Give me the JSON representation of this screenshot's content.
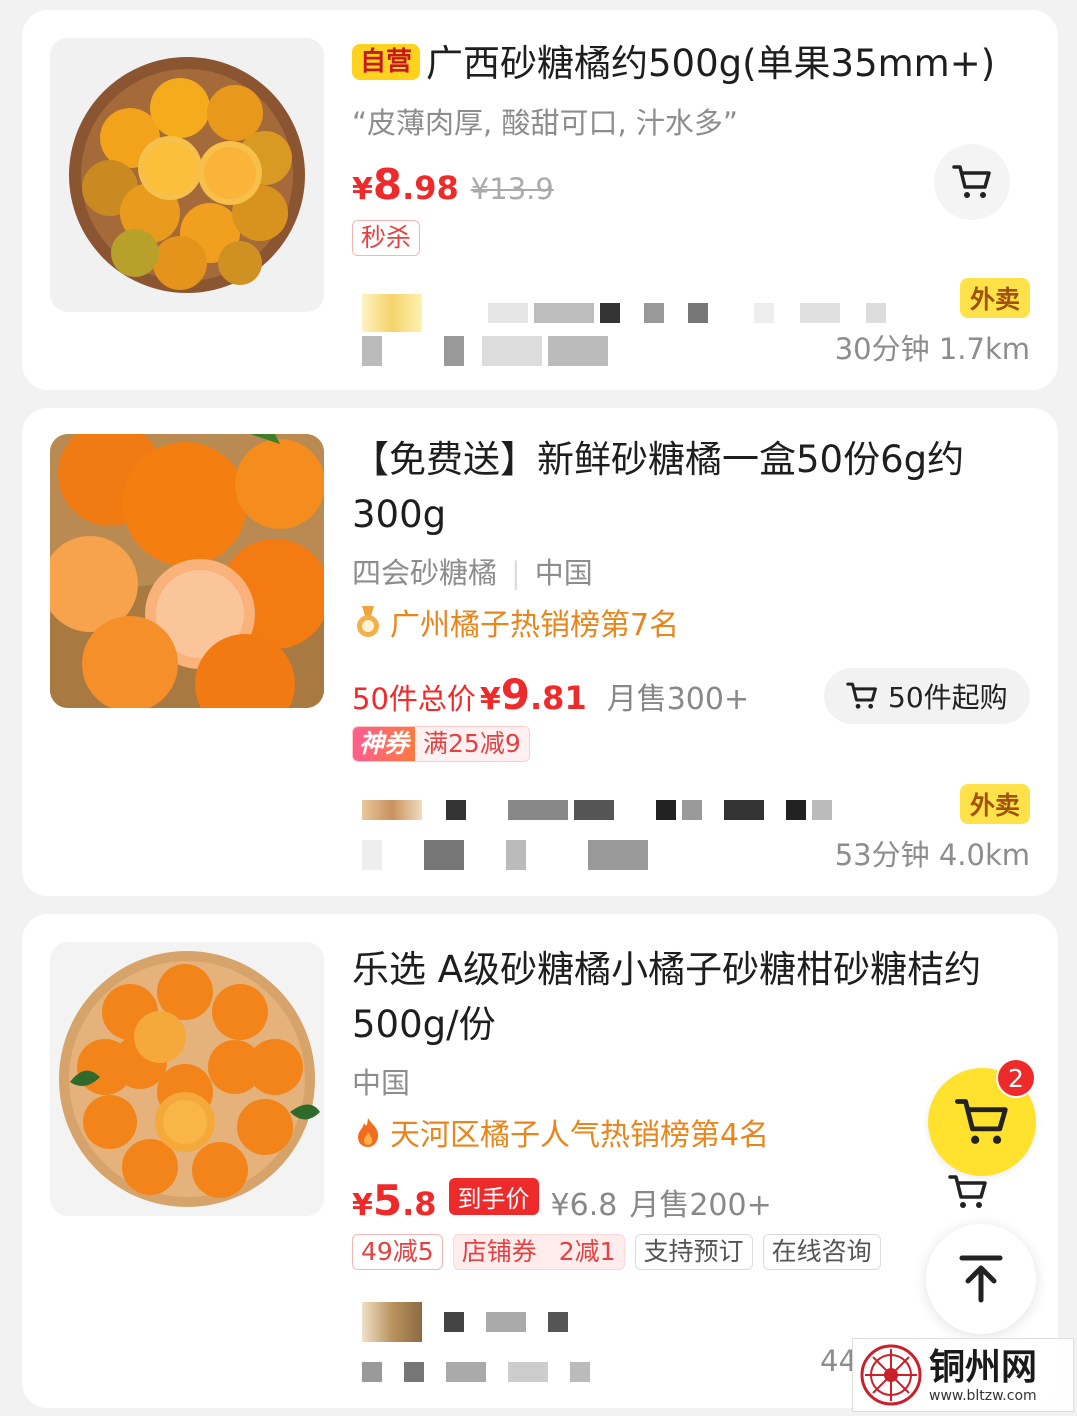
{
  "colors": {
    "price_red": "#ee2a2a",
    "tag_yellow": "#ffd21e",
    "rank_orange": "#e8851b",
    "fab_yellow": "#ffe12e"
  },
  "products": [
    {
      "tag": "自营",
      "title": "广西砂糖橘约500g(单果35mm+)",
      "slogan": "“皮薄肉厚, 酸甜可口, 汁水多”",
      "price_symbol": "¥",
      "price_int": "8",
      "price_dec": ".98",
      "price_old": "¥13.9",
      "chip": "秒杀",
      "delivery_tag": "外卖",
      "delivery_info": "30分钟  1.7km",
      "cart_icon": "cart-icon"
    },
    {
      "title": "【免费送】新鲜砂糖橘一盒50份6g约300g",
      "origin": "四会砂糖橘",
      "country": "中国",
      "rank": "广州橘子热销榜第7名",
      "total_label": "50件总价",
      "price_symbol": "¥",
      "price_int": "9",
      "price_dec": ".81",
      "sales": "月售300+",
      "buy_button": "50件起购",
      "coupon_a": "神券",
      "coupon_b": "满25减9",
      "delivery_tag": "外卖",
      "delivery_info": "53分钟  4.0km"
    },
    {
      "title": "乐选 A级砂糖橘小橘子砂糖柑砂糖桔约500g/份",
      "country": "中国",
      "rank": "天河区橘子人气热销榜第4名",
      "price_symbol": "¥",
      "price_int": "5",
      "price_dec": ".8",
      "price_tag": "到手价",
      "price_ref": "¥6.8",
      "sales": "月售200+",
      "chips": [
        "49减5",
        "店铺券",
        "2减1",
        "支持预订",
        "在线咨询"
      ],
      "delivery_info": "44"
    }
  ],
  "floating": {
    "cart_badge": "2",
    "cart_icon": "cart-icon",
    "top_icon": "arrow-up-icon"
  },
  "watermark": {
    "name": "铜州网",
    "url": "www.bltzw.com"
  }
}
